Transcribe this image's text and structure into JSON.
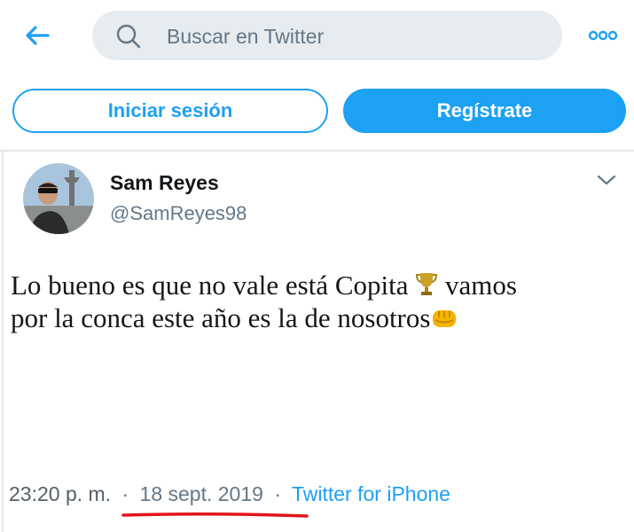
{
  "header": {
    "back_icon": "arrow-left-icon",
    "search": {
      "placeholder": "Buscar en Twitter",
      "icon": "search-icon"
    },
    "more_icon": "more-dots-icon"
  },
  "auth": {
    "login_label": "Iniciar sesión",
    "signup_label": "Regístrate"
  },
  "tweet": {
    "author_name": "Sam Reyes",
    "author_handle": "@SamReyes98",
    "text_line1": "Lo bueno es que no vale está Copita",
    "text_line1_end": "vamos",
    "text_line2": "por la conca este año es la de nosotros",
    "emoji_1": "trophy-icon",
    "emoji_2": "fist-icon",
    "time": "23:20 p. m.",
    "separator": "·",
    "date": "18 sept. 2019",
    "source": "Twitter for iPhone"
  },
  "colors": {
    "accent": "#1da1f2",
    "secondary_text": "#657786",
    "search_bg": "#e6ecf0",
    "annotation_red": "#e0151d"
  }
}
